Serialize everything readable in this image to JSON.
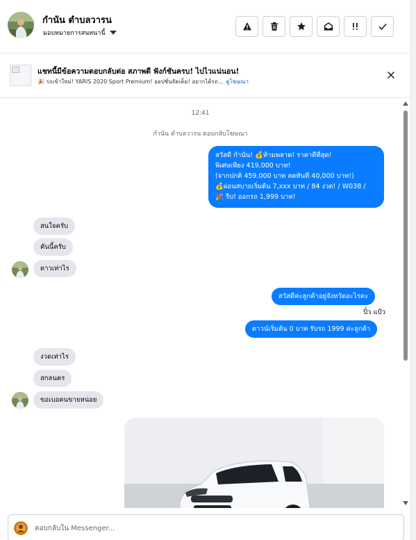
{
  "header": {
    "name": "กำนัน ตำบลวารน",
    "assign_label": "มอบหมายการสนทนานี้",
    "actions": [
      "warning-icon",
      "trash-icon",
      "star-icon",
      "mark-unread-icon",
      "follow-up-icon",
      "check-icon"
    ]
  },
  "ad": {
    "title": "แชทนี้มีข้อความตอบกลับต่อ สภาพดี ฟังก์ชันครบ! ไปไวแน่นอน!",
    "subtitle": "🎉 รถเข้าใหม่! YARIS 2020 Sport Premium! ออปชั่นจัดเต็ม! อยากได้รถ...",
    "link": "ดูโฆษณา"
  },
  "chat": {
    "time": "12:41",
    "reply_note": "กำนัน ตำบลวารน ตอบกลับโฆษณา",
    "first_message": [
      "สวัสดี กำนัน! 💰ห้ามพลาด! ราคาดีที่สุด!",
      "พิเศษเพียง 419,000 บาท!",
      "(จากปกติ 459,000 บาท ลดทันที 40,000 บาท!)",
      "💰ผ่อนสบายเริ่มต้น 7,xxx บาท / 84 งวด! / W038 /",
      "🎉 รีบ! ออกรถ 1,999 บาท!"
    ],
    "incoming_1": [
      "สนใจครับ",
      "คันนี้ครับ",
      "ดาวเท่าไร"
    ],
    "outgoing_2": "สวัสดีค่ะลูกค้าอยู่จังหวัดอะไรคะ",
    "sender_name": "ปิ๋ว แป้ว",
    "outgoing_3": "ดาวน์เริ่มต้น 0 บาท รับรถ 1999 ค่ะลูกค้า",
    "incoming_2": [
      "งวดเท่าไร",
      "สกลนคร",
      "ขอเบอคนขายหน่อย"
    ]
  },
  "composer": {
    "placeholder": "ตอบกลับใน Messenger..."
  },
  "colors": {
    "outgoing": "#0a7cff",
    "incoming": "#e4e6eb",
    "car": "#ffffff"
  }
}
